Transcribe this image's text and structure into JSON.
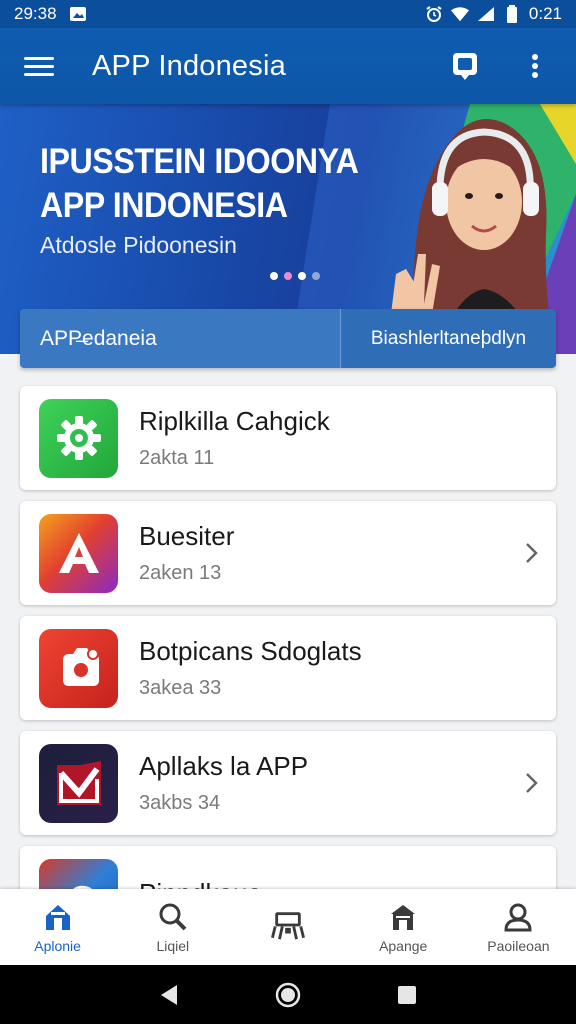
{
  "status_bar": {
    "time_left": "29:38",
    "time_right": "0:21"
  },
  "app_bar": {
    "title": "APP Indonesia"
  },
  "banner": {
    "title_line1": "IPUSSTEIN IDOONYA",
    "title_line2": "APP INDONESIA",
    "subtitle": "Atdosle Pidoonesin",
    "carousel_dots": 4,
    "active_dot": 0
  },
  "banner_tabs": [
    {
      "label": "APP̶edaneia"
    },
    {
      "label": "Biashlerltaneþdlyn"
    }
  ],
  "apps": [
    {
      "name": "Riplkilla Cahgick",
      "meta": "2akta 11",
      "icon": "gear-icon",
      "color": "#2fbf4a",
      "chevron": false
    },
    {
      "name": "Buesiter",
      "meta": "2aken 13",
      "icon": "letter-a-icon",
      "color": "#e2402f",
      "chevron": true
    },
    {
      "name": "Botpicans Sdoglats",
      "meta": "3akea 33",
      "icon": "camera-icon",
      "color": "#d9332a",
      "chevron": false
    },
    {
      "name": "Apllaks la APP",
      "meta": "3akbs 34",
      "icon": "check-shield-icon",
      "color": "#1c1f3a",
      "chevron": true
    },
    {
      "name": "Pinndkaue",
      "meta": "",
      "icon": "cloud-icon",
      "color": "#2070c8",
      "chevron": false
    }
  ],
  "bottom_nav": [
    {
      "label": "Aplonie",
      "icon": "home-icon",
      "active": true
    },
    {
      "label": "Liqiel",
      "icon": "search-icon",
      "active": false
    },
    {
      "label": "",
      "icon": "toolbox-icon",
      "active": false
    },
    {
      "label": "Apange",
      "icon": "store-icon",
      "active": false
    },
    {
      "label": "Paoileoan",
      "icon": "profile-icon",
      "active": false
    }
  ],
  "colors": {
    "primary": "#0f5cb0",
    "accent": "#1863c4"
  }
}
